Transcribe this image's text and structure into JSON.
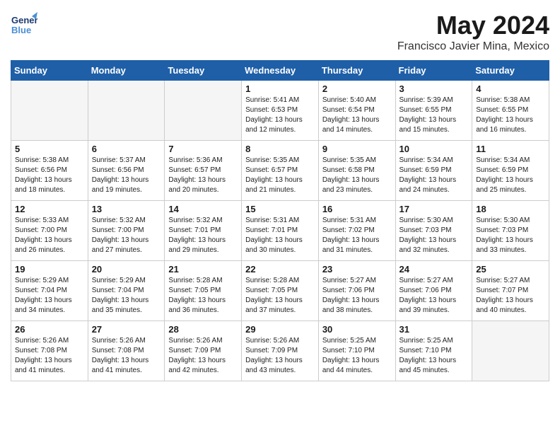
{
  "header": {
    "logo_general": "General",
    "logo_blue": "Blue",
    "title": "May 2024",
    "subtitle": "Francisco Javier Mina, Mexico"
  },
  "days_of_week": [
    "Sunday",
    "Monday",
    "Tuesday",
    "Wednesday",
    "Thursday",
    "Friday",
    "Saturday"
  ],
  "weeks": [
    [
      {
        "day": "",
        "sunrise": "",
        "sunset": "",
        "daylight": "",
        "empty": true
      },
      {
        "day": "",
        "sunrise": "",
        "sunset": "",
        "daylight": "",
        "empty": true
      },
      {
        "day": "",
        "sunrise": "",
        "sunset": "",
        "daylight": "",
        "empty": true
      },
      {
        "day": "1",
        "sunrise": "Sunrise: 5:41 AM",
        "sunset": "Sunset: 6:53 PM",
        "daylight": "Daylight: 13 hours and 12 minutes."
      },
      {
        "day": "2",
        "sunrise": "Sunrise: 5:40 AM",
        "sunset": "Sunset: 6:54 PM",
        "daylight": "Daylight: 13 hours and 14 minutes."
      },
      {
        "day": "3",
        "sunrise": "Sunrise: 5:39 AM",
        "sunset": "Sunset: 6:55 PM",
        "daylight": "Daylight: 13 hours and 15 minutes."
      },
      {
        "day": "4",
        "sunrise": "Sunrise: 5:38 AM",
        "sunset": "Sunset: 6:55 PM",
        "daylight": "Daylight: 13 hours and 16 minutes."
      }
    ],
    [
      {
        "day": "5",
        "sunrise": "Sunrise: 5:38 AM",
        "sunset": "Sunset: 6:56 PM",
        "daylight": "Daylight: 13 hours and 18 minutes."
      },
      {
        "day": "6",
        "sunrise": "Sunrise: 5:37 AM",
        "sunset": "Sunset: 6:56 PM",
        "daylight": "Daylight: 13 hours and 19 minutes."
      },
      {
        "day": "7",
        "sunrise": "Sunrise: 5:36 AM",
        "sunset": "Sunset: 6:57 PM",
        "daylight": "Daylight: 13 hours and 20 minutes."
      },
      {
        "day": "8",
        "sunrise": "Sunrise: 5:35 AM",
        "sunset": "Sunset: 6:57 PM",
        "daylight": "Daylight: 13 hours and 21 minutes."
      },
      {
        "day": "9",
        "sunrise": "Sunrise: 5:35 AM",
        "sunset": "Sunset: 6:58 PM",
        "daylight": "Daylight: 13 hours and 23 minutes."
      },
      {
        "day": "10",
        "sunrise": "Sunrise: 5:34 AM",
        "sunset": "Sunset: 6:59 PM",
        "daylight": "Daylight: 13 hours and 24 minutes."
      },
      {
        "day": "11",
        "sunrise": "Sunrise: 5:34 AM",
        "sunset": "Sunset: 6:59 PM",
        "daylight": "Daylight: 13 hours and 25 minutes."
      }
    ],
    [
      {
        "day": "12",
        "sunrise": "Sunrise: 5:33 AM",
        "sunset": "Sunset: 7:00 PM",
        "daylight": "Daylight: 13 hours and 26 minutes."
      },
      {
        "day": "13",
        "sunrise": "Sunrise: 5:32 AM",
        "sunset": "Sunset: 7:00 PM",
        "daylight": "Daylight: 13 hours and 27 minutes."
      },
      {
        "day": "14",
        "sunrise": "Sunrise: 5:32 AM",
        "sunset": "Sunset: 7:01 PM",
        "daylight": "Daylight: 13 hours and 29 minutes."
      },
      {
        "day": "15",
        "sunrise": "Sunrise: 5:31 AM",
        "sunset": "Sunset: 7:01 PM",
        "daylight": "Daylight: 13 hours and 30 minutes."
      },
      {
        "day": "16",
        "sunrise": "Sunrise: 5:31 AM",
        "sunset": "Sunset: 7:02 PM",
        "daylight": "Daylight: 13 hours and 31 minutes."
      },
      {
        "day": "17",
        "sunrise": "Sunrise: 5:30 AM",
        "sunset": "Sunset: 7:03 PM",
        "daylight": "Daylight: 13 hours and 32 minutes."
      },
      {
        "day": "18",
        "sunrise": "Sunrise: 5:30 AM",
        "sunset": "Sunset: 7:03 PM",
        "daylight": "Daylight: 13 hours and 33 minutes."
      }
    ],
    [
      {
        "day": "19",
        "sunrise": "Sunrise: 5:29 AM",
        "sunset": "Sunset: 7:04 PM",
        "daylight": "Daylight: 13 hours and 34 minutes."
      },
      {
        "day": "20",
        "sunrise": "Sunrise: 5:29 AM",
        "sunset": "Sunset: 7:04 PM",
        "daylight": "Daylight: 13 hours and 35 minutes."
      },
      {
        "day": "21",
        "sunrise": "Sunrise: 5:28 AM",
        "sunset": "Sunset: 7:05 PM",
        "daylight": "Daylight: 13 hours and 36 minutes."
      },
      {
        "day": "22",
        "sunrise": "Sunrise: 5:28 AM",
        "sunset": "Sunset: 7:05 PM",
        "daylight": "Daylight: 13 hours and 37 minutes."
      },
      {
        "day": "23",
        "sunrise": "Sunrise: 5:27 AM",
        "sunset": "Sunset: 7:06 PM",
        "daylight": "Daylight: 13 hours and 38 minutes."
      },
      {
        "day": "24",
        "sunrise": "Sunrise: 5:27 AM",
        "sunset": "Sunset: 7:06 PM",
        "daylight": "Daylight: 13 hours and 39 minutes."
      },
      {
        "day": "25",
        "sunrise": "Sunrise: 5:27 AM",
        "sunset": "Sunset: 7:07 PM",
        "daylight": "Daylight: 13 hours and 40 minutes."
      }
    ],
    [
      {
        "day": "26",
        "sunrise": "Sunrise: 5:26 AM",
        "sunset": "Sunset: 7:08 PM",
        "daylight": "Daylight: 13 hours and 41 minutes."
      },
      {
        "day": "27",
        "sunrise": "Sunrise: 5:26 AM",
        "sunset": "Sunset: 7:08 PM",
        "daylight": "Daylight: 13 hours and 41 minutes."
      },
      {
        "day": "28",
        "sunrise": "Sunrise: 5:26 AM",
        "sunset": "Sunset: 7:09 PM",
        "daylight": "Daylight: 13 hours and 42 minutes."
      },
      {
        "day": "29",
        "sunrise": "Sunrise: 5:26 AM",
        "sunset": "Sunset: 7:09 PM",
        "daylight": "Daylight: 13 hours and 43 minutes."
      },
      {
        "day": "30",
        "sunrise": "Sunrise: 5:25 AM",
        "sunset": "Sunset: 7:10 PM",
        "daylight": "Daylight: 13 hours and 44 minutes."
      },
      {
        "day": "31",
        "sunrise": "Sunrise: 5:25 AM",
        "sunset": "Sunset: 7:10 PM",
        "daylight": "Daylight: 13 hours and 45 minutes."
      },
      {
        "day": "",
        "sunrise": "",
        "sunset": "",
        "daylight": "",
        "empty": true
      }
    ]
  ]
}
